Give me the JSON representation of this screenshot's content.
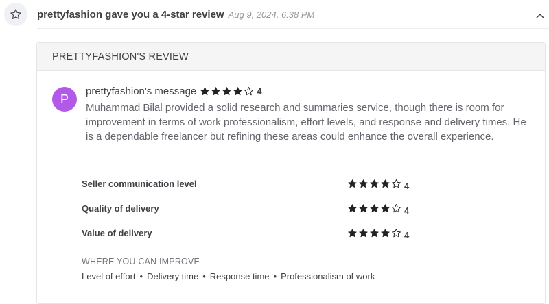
{
  "header": {
    "icon": "star-outline-icon",
    "title": "prettyfashion gave you a 4-star review",
    "timestamp": "Aug 9, 2024, 6:38 PM",
    "collapse_icon": "chevron-up-icon"
  },
  "review": {
    "heading": "PRETTYFASHION'S REVIEW",
    "avatar_letter": "P",
    "avatar_color": "#b15ae7",
    "message_label": "prettyfashion's message",
    "overall_rating": 4,
    "overall_rating_text": "4",
    "message": "Muhammad Bilal provided a solid research and summaries service, though there is room for improvement in terms of work professionalism, effort levels, and response and delivery times. He is a dependable freelancer but refining these areas could enhance the overall experience.",
    "ratings": [
      {
        "label": "Seller communication level",
        "value": 4,
        "value_text": "4"
      },
      {
        "label": "Quality of delivery",
        "value": 4,
        "value_text": "4"
      },
      {
        "label": "Value of delivery",
        "value": 4,
        "value_text": "4"
      }
    ],
    "improve_heading": "WHERE YOU CAN IMPROVE",
    "improve_items": [
      "Level of effort",
      "Delivery time",
      "Response time",
      "Professionalism of work"
    ],
    "improve_separator": "•"
  },
  "colors": {
    "star_filled": "#222325",
    "text_dark": "#404145",
    "text_muted": "#62646a"
  }
}
